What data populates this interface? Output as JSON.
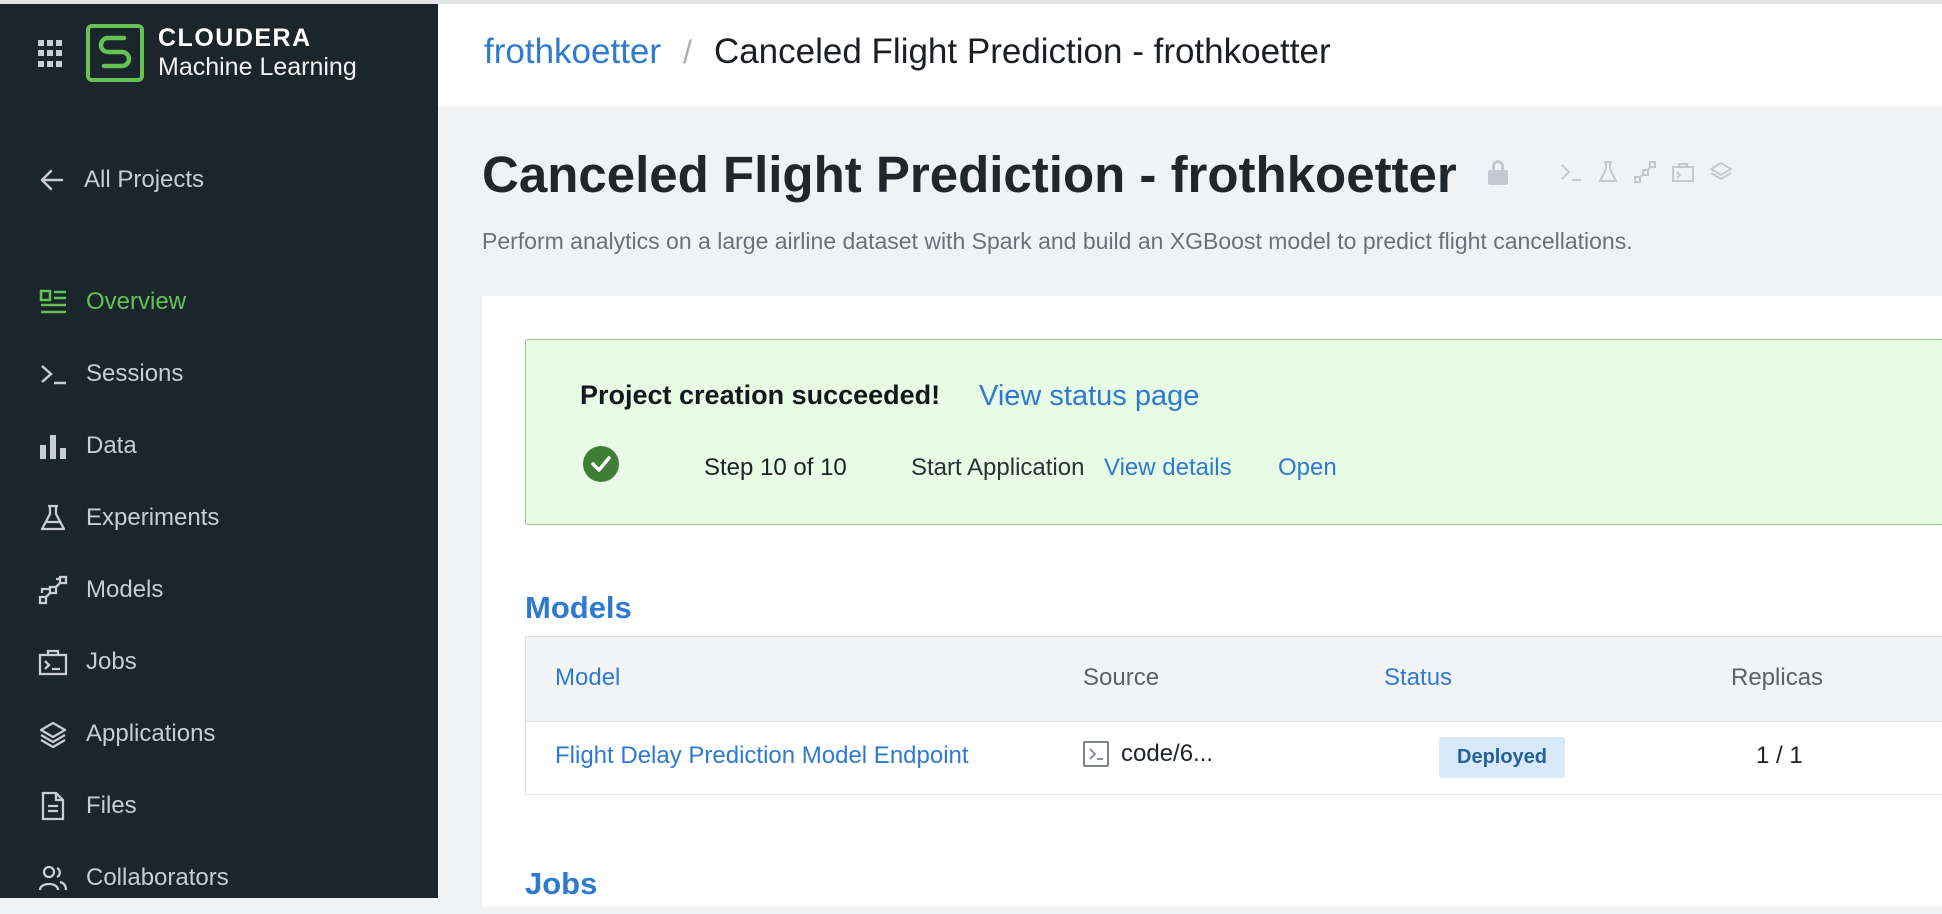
{
  "sidebar": {
    "brand_line1": "CLOUDERA",
    "brand_line2": "Machine Learning",
    "back_label": "All Projects",
    "accent_color": "#64c254",
    "items": [
      {
        "label": "Overview",
        "icon": "overview-icon",
        "active": true
      },
      {
        "label": "Sessions",
        "icon": "terminal-icon"
      },
      {
        "label": "Data",
        "icon": "bar-chart-icon"
      },
      {
        "label": "Experiments",
        "icon": "flask-icon"
      },
      {
        "label": "Models",
        "icon": "models-icon"
      },
      {
        "label": "Jobs",
        "icon": "jobs-icon"
      },
      {
        "label": "Applications",
        "icon": "layers-icon"
      },
      {
        "label": "Files",
        "icon": "file-icon"
      },
      {
        "label": "Collaborators",
        "icon": "users-icon"
      }
    ]
  },
  "header": {
    "breadcrumb_user": "frothkoetter",
    "breadcrumb_sep": "/",
    "breadcrumb_project": "Canceled Flight Prediction - frothkoetter"
  },
  "project": {
    "title": "Canceled Flight Prediction - frothkoetter",
    "description": "Perform analytics on a large airline dataset with Spark and build an XGBoost model to predict flight cancellations."
  },
  "banner": {
    "message": "Project creation succeeded!",
    "status_link": "View status page",
    "step": "Step 10 of 10",
    "step_name": "Start Application",
    "details_link": "View details",
    "open_link": "Open",
    "bg_color": "#e8fbe4"
  },
  "models": {
    "heading": "Models",
    "columns": {
      "model": "Model",
      "source": "Source",
      "status": "Status",
      "replicas": "Replicas"
    },
    "rows": [
      {
        "model": "Flight Delay Prediction Model Endpoint",
        "source": "code/6...",
        "status": "Deployed",
        "replicas": "1 / 1"
      }
    ]
  },
  "jobs": {
    "heading": "Jobs"
  }
}
